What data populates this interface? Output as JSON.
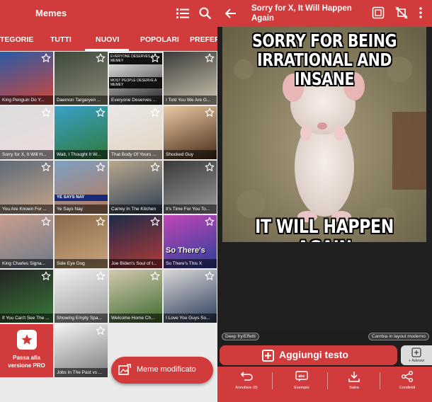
{
  "left": {
    "app_title": "Memes",
    "tabs": [
      "TEGORIE",
      "TUTTI",
      "NUOVI",
      "POPOLARI",
      "PREFERI"
    ],
    "active_tab": "NUOVI",
    "grid": [
      {
        "caption": "King Penguin Do Y..."
      },
      {
        "caption": "Daemon Targaryen ..."
      },
      {
        "caption": "Everyone Deserves ...",
        "top_text": "EVERYONE DESERVES A MEMEY",
        "mid_text": "MOST PEOPLE DESERVE A MEMEY"
      },
      {
        "caption": "I Told You We Are G..."
      },
      {
        "caption": "Sorry for X, It Will H..."
      },
      {
        "caption": "Wait, I Thought It W..."
      },
      {
        "caption": "That Body Of Yours ..."
      },
      {
        "caption": "Shocked Guy"
      },
      {
        "caption": "You Are Known For ..."
      },
      {
        "caption": "Ye Says Nay",
        "banner": "YE SAYS NAY"
      },
      {
        "caption": "Carrey In The Kitchen"
      },
      {
        "caption": "It's Time For You To..."
      },
      {
        "caption": "King Charles Signa..."
      },
      {
        "caption": "Side Eye Dog"
      },
      {
        "caption": "Joe Biden's Soul of t..."
      },
      {
        "caption": "So There's This X",
        "overlay": "So There's"
      },
      {
        "caption": "If You Can't See The ..."
      },
      {
        "caption": "Showing Empty Spa..."
      },
      {
        "caption": "Welcome Home Ch..."
      },
      {
        "caption": "I Love You Guys So..."
      },
      {
        "caption": "Jobs In The Past vs ..."
      }
    ],
    "promo": {
      "line1": "Passa alla",
      "line2": "versione PRO"
    },
    "fab_label": "Meme modificato"
  },
  "right": {
    "title": "Sorry for X, It Will Happen Again",
    "meme_top": [
      "SORRY FOR BEING",
      "IRRATIONAL AND INSANE"
    ],
    "meme_bottom": "IT WILL HAPPEN AGAIN",
    "pill_left": "Deep fry/Effetti",
    "pill_right": "Cambia in layout moderno",
    "add_text": "Aggiungi testo",
    "sticker_label": "+ Adesivi",
    "bottom": [
      {
        "label": "Annullare (8)",
        "icon": "undo-icon"
      },
      {
        "label": "Esempio",
        "icon": "abc-icon"
      },
      {
        "label": "Salva",
        "icon": "download-icon"
      },
      {
        "label": "Condividi",
        "icon": "share-icon"
      }
    ]
  },
  "colors": {
    "accent": "#d13b3b",
    "dark": "#1f1f1f"
  }
}
